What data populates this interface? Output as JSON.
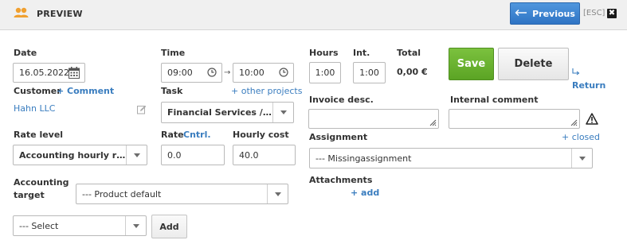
{
  "header": {
    "title": "PREVIEW",
    "previous_label": "Previous",
    "esc_label": "[ESC]",
    "close_glyph": "✖",
    "accent": "#3a82d0"
  },
  "date": {
    "label": "Date",
    "value": "16.05.2022"
  },
  "customer": {
    "label": "Customer",
    "comment_link": "+ Comment",
    "value": "Hahn LLC"
  },
  "time": {
    "label": "Time",
    "from": "09:00",
    "arrow": "→",
    "to": "10:00"
  },
  "task": {
    "label": "Task",
    "other_projects_link": "+ other projects",
    "value": "Financial Services / Acc..."
  },
  "hours": {
    "label": "Hours",
    "value": "1:00"
  },
  "internal": {
    "label": "Int.",
    "value": "1:00"
  },
  "total": {
    "label": "Total",
    "value": "0,00 €"
  },
  "actions": {
    "save": "Save",
    "delete": "Delete",
    "return": "Return",
    "save_color": "#6bb330"
  },
  "invoice_desc": {
    "label": "Invoice desc.",
    "value": ""
  },
  "internal_comment": {
    "label": "Internal comment",
    "value": ""
  },
  "rate_level": {
    "label": "Rate level",
    "value": "Accounting hourly rate"
  },
  "rate": {
    "label": "Rate",
    "cntrl_link": "Cntrl.",
    "value": "0.0"
  },
  "hourly_cost": {
    "label": "Hourly cost",
    "value": "40.0"
  },
  "assignment": {
    "label": "Assignment",
    "closed_link": "+ closed",
    "value": "--- Missingassignment"
  },
  "accounting_target": {
    "label_line1": "Accounting",
    "label_line2": "target",
    "value": "--- Product default"
  },
  "attachments": {
    "label": "Attachments",
    "add_link": "+ add"
  },
  "bottom": {
    "select_value": "--- Select",
    "add_button": "Add"
  }
}
